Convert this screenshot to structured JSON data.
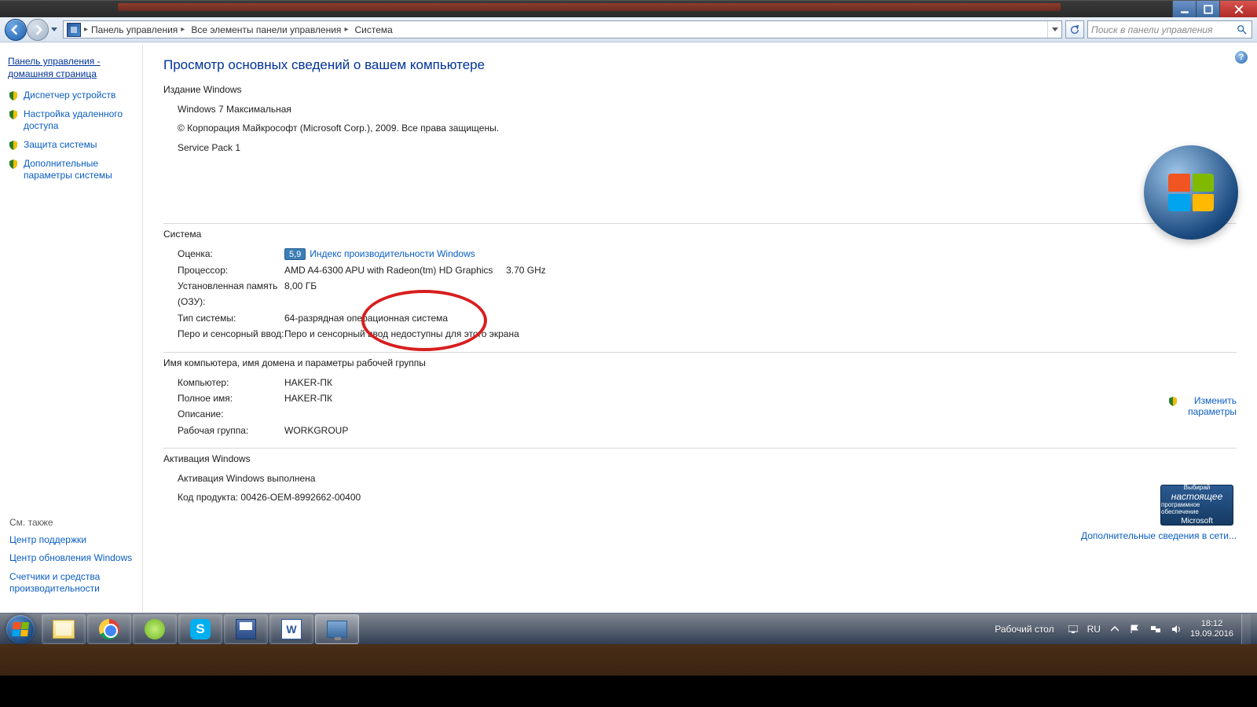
{
  "titlebar": {},
  "nav": {
    "breadcrumbs": [
      "Панель управления",
      "Все элементы панели управления",
      "Система"
    ],
    "search_placeholder": "Поиск в панели управления"
  },
  "sidebar": {
    "home": "Панель управления - домашняя страница",
    "links": [
      "Диспетчер устройств",
      "Настройка удаленного доступа",
      "Защита системы",
      "Дополнительные параметры системы"
    ],
    "seealso_h": "См. также",
    "seealso": [
      "Центр поддержки",
      "Центр обновления Windows",
      "Счетчики и средства производительности"
    ]
  },
  "content": {
    "title": "Просмотр основных сведений о вашем компьютере",
    "edition_h": "Издание Windows",
    "edition_name": "Windows 7 Максимальная",
    "copyright": "© Корпорация Майкрософт (Microsoft Corp.), 2009. Все права защищены.",
    "sp": "Service Pack 1",
    "system_h": "Система",
    "rating_label": "Оценка:",
    "rating_score": "5,9",
    "rating_link": "Индекс производительности Windows",
    "cpu_label": "Процессор:",
    "cpu_val": "AMD A4-6300 APU with Radeon(tm) HD Graphics     3.70 GHz",
    "ram_label": "Установленная память (ОЗУ):",
    "ram_val": "8,00 ГБ",
    "type_label": "Тип системы:",
    "type_val": "64-разрядная операционная система",
    "pen_label": "Перо и сенсорный ввод:",
    "pen_val": "Перо и сенсорный ввод недоступны для этого экрана",
    "name_h": "Имя компьютера, имя домена и параметры рабочей группы",
    "comp_label": "Компьютер:",
    "comp_val": "HAKER-ПК",
    "full_label": "Полное имя:",
    "full_val": "HAKER-ПК",
    "desc_label": "Описание:",
    "desc_val": "",
    "wg_label": "Рабочая группа:",
    "wg_val": "WORKGROUP",
    "change_link": "Изменить параметры",
    "act_h": "Активация Windows",
    "act_status": "Активация Windows выполнена",
    "pid_label": "Код продукта: ",
    "pid_val": "00426-OEM-8992662-00400",
    "genuine_top": "Выбирай",
    "genuine_mid": "настоящее",
    "genuine_sub": "программное обеспечение",
    "genuine_ms": "Microsoft",
    "more_link": "Дополнительные сведения в сети..."
  },
  "taskbar": {
    "desktop_label": "Рабочий стол",
    "lang": "RU",
    "time": "18:12",
    "date": "19.09.2016"
  }
}
